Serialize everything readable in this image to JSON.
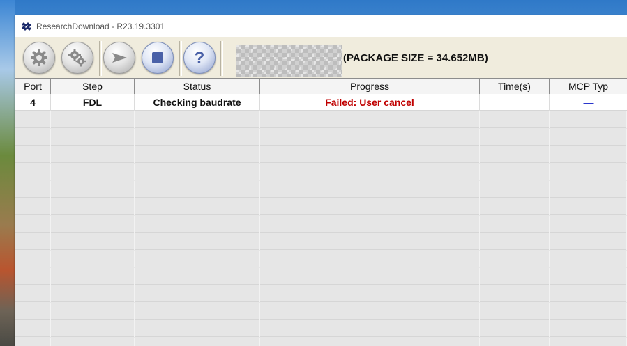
{
  "window": {
    "title": "ResearchDownload - R23.19.3301"
  },
  "toolbar": {
    "buttons": [
      {
        "name": "settings-button",
        "icon": "gear-icon"
      },
      {
        "name": "advanced-settings-button",
        "icon": "gears-icon"
      },
      {
        "name": "start-button",
        "icon": "play-arrow-icon"
      },
      {
        "name": "stop-button",
        "icon": "stop-square-icon"
      },
      {
        "name": "help-button",
        "icon": "question-icon"
      }
    ],
    "package_size": "(PACKAGE SIZE = 34.652MB)"
  },
  "table": {
    "columns": [
      "Port",
      "Step",
      "Status",
      "Progress",
      "Time(s)",
      "MCP Typ"
    ],
    "rows": [
      {
        "port": "4",
        "step": "FDL",
        "status": "Checking baudrate",
        "progress": "Failed: User cancel",
        "time": "",
        "mcp": "—"
      }
    ]
  },
  "colors": {
    "toolbar_bg": "#f0ecdd",
    "grid_bg": "#e6e6e6",
    "error_text": "#c00000",
    "mcp_text": "#1a27c9"
  }
}
